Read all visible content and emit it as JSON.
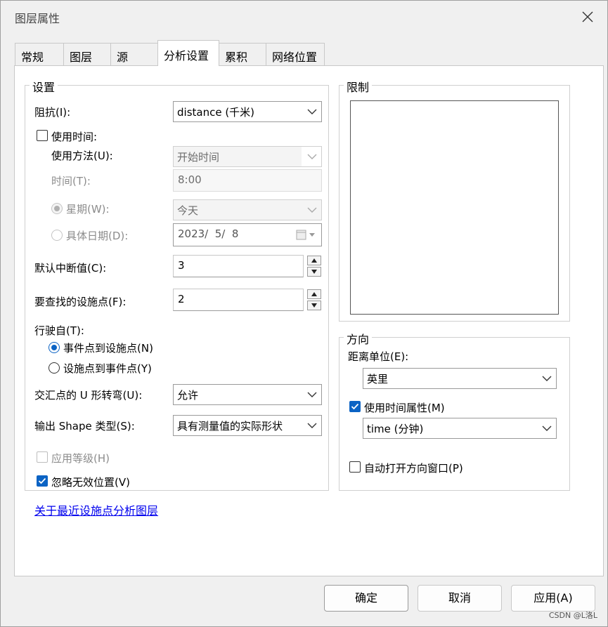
{
  "window": {
    "title": "图层属性"
  },
  "tabs": [
    {
      "label": "常规"
    },
    {
      "label": "图层"
    },
    {
      "label": "源"
    },
    {
      "label": "分析设置",
      "active": true
    },
    {
      "label": "累积"
    },
    {
      "label": "网络位置"
    }
  ],
  "settings": {
    "group_title": "设置",
    "impedance": {
      "label": "阻抗(I):",
      "value": "distance (千米)"
    },
    "use_time": {
      "label": "使用时间:",
      "checked": false
    },
    "method": {
      "label": "使用方法(U):",
      "value": "开始时间"
    },
    "time": {
      "label": "时间(T):",
      "value": "8:00"
    },
    "weekday": {
      "label": "星期(W):",
      "value": "今天",
      "checked": true
    },
    "specific_date": {
      "label": "具体日期(D):",
      "value": "2023/  5/  8",
      "checked": false
    },
    "default_cutoff": {
      "label": "默认中断值(C):",
      "value": "3"
    },
    "facilities_to_find": {
      "label": "要查找的设施点(F):",
      "value": "2"
    },
    "travel_from": {
      "label": "行驶自(T):",
      "options": [
        {
          "label": "事件点到设施点(N)",
          "checked": true
        },
        {
          "label": "设施点到事件点(Y)",
          "checked": false
        }
      ]
    },
    "u_turns": {
      "label": "交汇点的 U 形转弯(U):",
      "value": "允许"
    },
    "output_shape": {
      "label": "输出 Shape 类型(S):",
      "value": "具有测量值的实际形状"
    },
    "use_hierarchy": {
      "label": "应用等级(H)",
      "checked": false
    },
    "ignore_invalid": {
      "label": "忽略无效位置(V)",
      "checked": true
    }
  },
  "restrictions": {
    "group_title": "限制"
  },
  "directions": {
    "group_title": "方向",
    "distance_units": {
      "label": "距离单位(E):",
      "value": "英里"
    },
    "use_time_attribute": {
      "label": "使用时间属性(M)",
      "checked": true,
      "value": "time (分钟)"
    },
    "auto_open": {
      "label": "自动打开方向窗口(P)",
      "checked": false
    }
  },
  "link": {
    "label": "关于最近设施点分析图层"
  },
  "buttons": {
    "ok": "确定",
    "cancel": "取消",
    "apply": "应用(A)"
  },
  "watermark": "CSDN @L洛L",
  "colors": {
    "accent": "#0b63c4",
    "link": "#0000ee"
  }
}
